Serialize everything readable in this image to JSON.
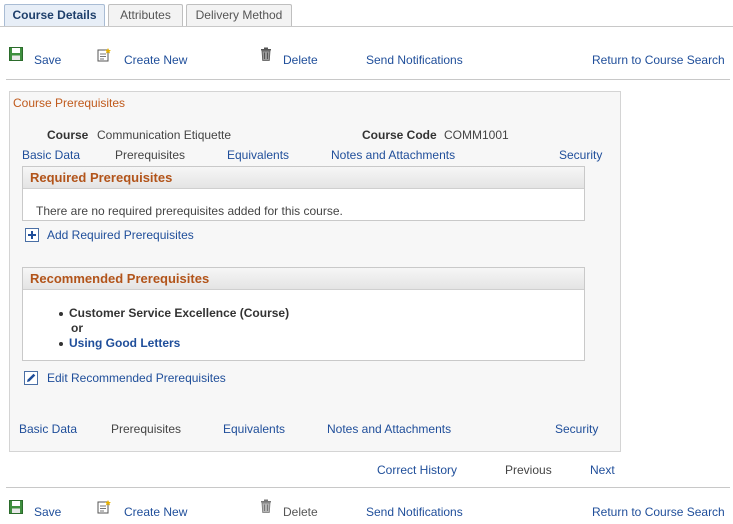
{
  "tabs": [
    {
      "label": "Course Details",
      "active": true
    },
    {
      "label": "Attributes",
      "active": false
    },
    {
      "label": "Delivery Method",
      "active": false
    }
  ],
  "toolbar": {
    "save": "Save",
    "create_new": "Create New",
    "delete": "Delete",
    "send_notifications": "Send Notifications",
    "return": "Return to Course Search"
  },
  "group": {
    "title": "Course Prerequisites",
    "course_label": "Course",
    "course_value": "Communication Etiquette",
    "code_label": "Course Code",
    "code_value": "COMM1001"
  },
  "subnav": {
    "basic_data": "Basic Data",
    "prerequisites": "Prerequisites",
    "equivalents": "Equivalents",
    "notes": "Notes and Attachments",
    "security": "Security"
  },
  "required": {
    "title": "Required Prerequisites",
    "empty_message": "There are no required prerequisites added for this course.",
    "add_link": "Add Required Prerequisites"
  },
  "recommended": {
    "title": "Recommended Prerequisites",
    "item1": "Customer Service Excellence (Course)",
    "connector": "or",
    "item2": "Using Good Letters",
    "edit_link": "Edit Recommended Prerequisites"
  },
  "pager": {
    "correct_history": "Correct History",
    "previous": "Previous",
    "next": "Next"
  },
  "colors": {
    "link": "#1f4e9a",
    "section_title": "#b2541a",
    "group_title": "#c05a1c"
  }
}
